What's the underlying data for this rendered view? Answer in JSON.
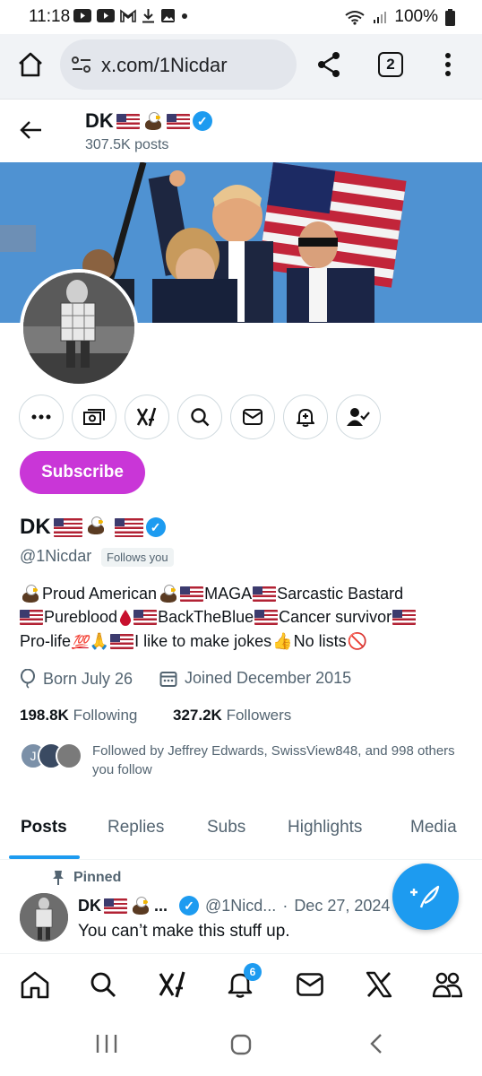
{
  "status_bar": {
    "time": "11:18",
    "battery": "100%"
  },
  "browser": {
    "url": "x.com/1Nicdar",
    "tab_count": "2"
  },
  "header": {
    "name": "DK",
    "posts": "307.5K posts"
  },
  "profile": {
    "name": "DK",
    "handle": "@1Nicdar",
    "follows_you": "Follows you",
    "subscribe_label": "Subscribe",
    "bio": {
      "line1": [
        "Proud American",
        "MAGA",
        "Sarcastic Bastard"
      ],
      "line2": [
        "Pureblood",
        "BackTheBlue",
        "Cancer survivor"
      ],
      "line3": [
        "Pro-life",
        "💯",
        "🙏",
        "I like to make jokes ",
        "👍",
        "No lists",
        "🚫"
      ]
    },
    "born": "Born July 26",
    "joined": "Joined December 2015",
    "following_count": "198.8K",
    "following_label": "Following",
    "followers_count": "327.2K",
    "followers_label": "Followers",
    "followed_by": "Followed by Jeffrey Edwards, SwissView848, and 998 others you follow",
    "followed_by_initial": "J"
  },
  "tabs": [
    "Posts",
    "Replies",
    "Subs",
    "Highlights",
    "Media"
  ],
  "pinned_post": {
    "pinned_label": "Pinned",
    "author": "DK",
    "ellipsis": "...",
    "handle": "@1Nicd...",
    "sep": "·",
    "date": "Dec 27, 2024",
    "text": "You can’t make this stuff up."
  },
  "nav": {
    "notifications_badge": "6"
  },
  "colors": {
    "accent": "#1d9bf0",
    "subscribe": "#c936d7"
  }
}
